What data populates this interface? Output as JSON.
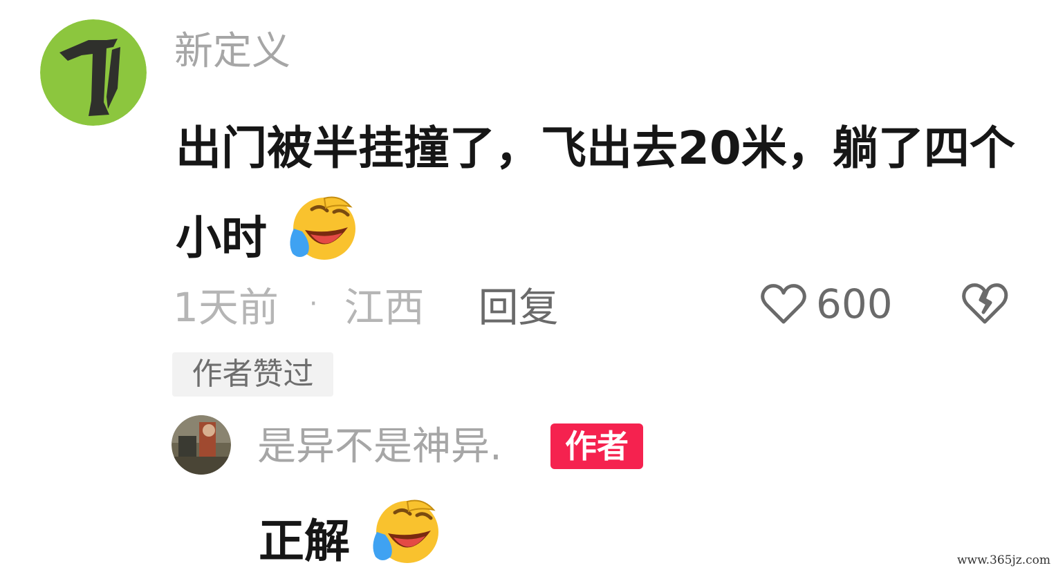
{
  "main_comment": {
    "username": "新定义",
    "text": "出门被半挂撞了，飞出去20米，躺了四个小时",
    "emoji": "laughing-crying-emoji",
    "time": "1天前",
    "separator": "·",
    "location": "江西",
    "reply_label": "回复",
    "like_count": "600",
    "author_liked_tag": "作者赞过"
  },
  "reply_comment": {
    "username": "是异不是神异.",
    "author_badge": "作者",
    "text": "正解",
    "emoji": "laughing-crying-emoji"
  },
  "watermark": "www.365jz.com",
  "colors": {
    "avatar_green": "#8cc63e",
    "author_badge": "#f5224f",
    "emoji_yellow": "#f9c22e",
    "tear_blue": "#3fa2f2"
  }
}
